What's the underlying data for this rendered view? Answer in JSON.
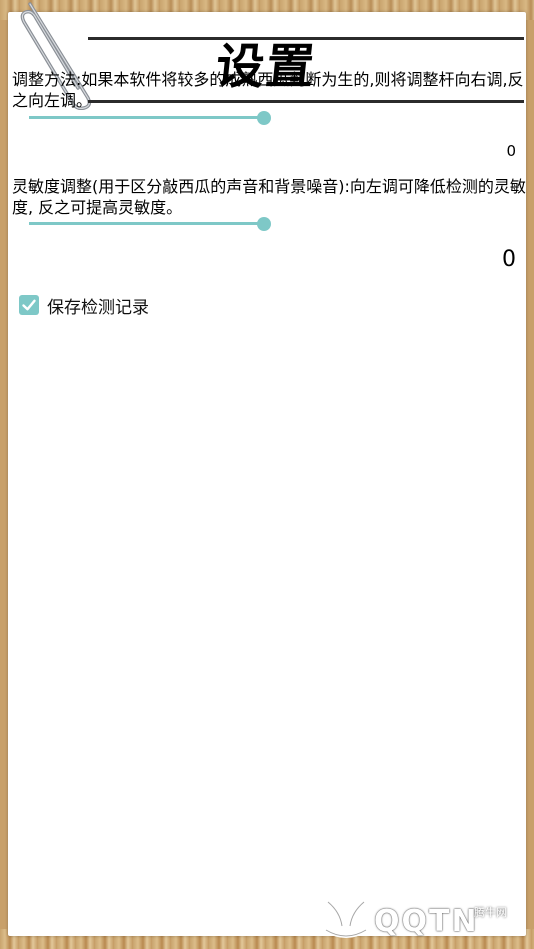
{
  "page": {
    "title": "设置"
  },
  "adjust": {
    "description": "调整方法:如果本软件将较多的成熟西瓜判断为生的,则将调整杆向右调,反之向左调。",
    "value": "0",
    "level": 0.96
  },
  "sensitivity": {
    "description": "灵敏度调整(用于区分敲西瓜的声音和背景噪音):向左调可降低检测的灵敏度, 反之可提高灵敏度。",
    "value": "0",
    "level": 0.96
  },
  "save_record": {
    "label": "保存检测记录",
    "checked": true
  },
  "watermark": {
    "brand": "QQTN",
    "small_text": "腾牛网"
  },
  "colors": {
    "accent": "#7ec8c7",
    "wood": "#c8a06a"
  },
  "icons": {
    "clip": "paperclip-icon",
    "check": "checkmark-icon",
    "logo": "qqtn-logo-icon"
  }
}
